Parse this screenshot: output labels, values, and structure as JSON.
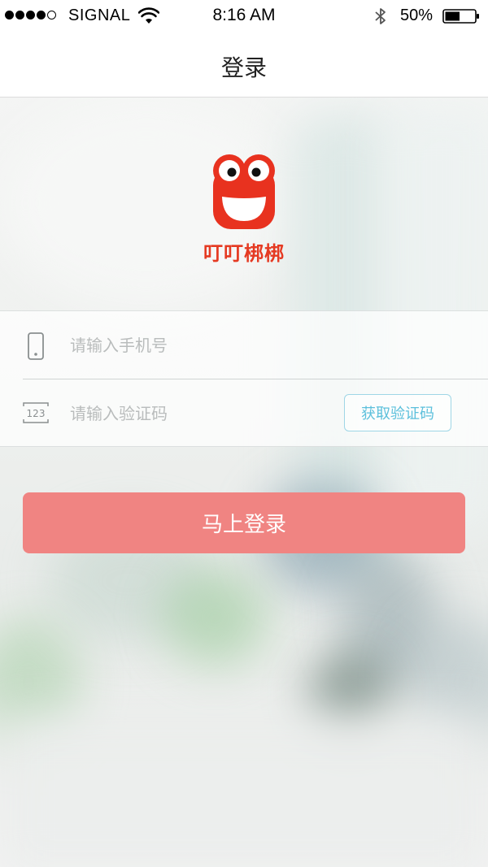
{
  "status_bar": {
    "carrier": "SIGNAL",
    "time": "8:16 AM",
    "battery": "50%",
    "battery_level": 0.5,
    "signal_bars": 4,
    "icons": [
      "wifi-icon",
      "bluetooth-icon",
      "battery-icon"
    ]
  },
  "nav": {
    "title": "登录"
  },
  "brand": {
    "name": "叮叮梆梆",
    "logo_icon": "frog-logo-icon",
    "color": "#e53a22"
  },
  "form": {
    "phone_placeholder": "请输入手机号",
    "phone_value": "",
    "phone_icon": "phone-icon",
    "code_placeholder": "请输入验证码",
    "code_value": "",
    "code_icon": "keypad-123-icon",
    "code_icon_text": "123",
    "get_code_label": "获取验证码"
  },
  "login": {
    "label": "马上登录",
    "color": "#f08482"
  }
}
